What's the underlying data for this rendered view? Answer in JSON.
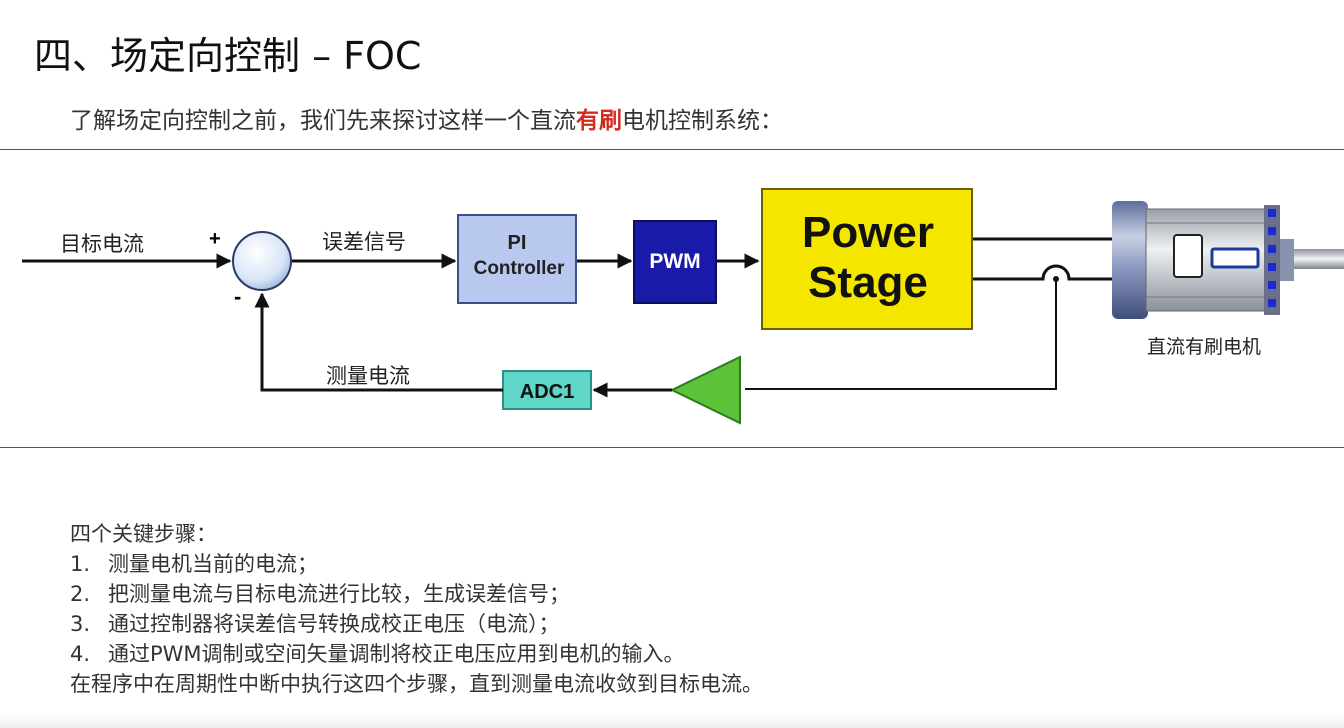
{
  "title": "四、场定向控制 – FOC",
  "intro": {
    "before": "了解场定向控制之前，我们先来探讨这样一个直流",
    "highlight": "有刷",
    "after": "电机控制系统："
  },
  "diagram": {
    "input_label": "目标电流",
    "plus_sign": "+",
    "minus_sign": "-",
    "error_label": "误差信号",
    "pi_line1": "PI",
    "pi_line2": "Controller",
    "pwm_label": "PWM",
    "power_line1": "Power",
    "power_line2": "Stage",
    "motor_label": "直流有刷电机",
    "feedback_label": "测量电流",
    "adc_label": "ADC1",
    "colors": {
      "pi_fill": "#b8c8ee",
      "pwm_fill": "#1a1aa8",
      "power_fill": "#f5e600",
      "adc_fill": "#5fd6c8",
      "amp_fill": "#5cc23a"
    }
  },
  "steps_heading": "四个关键步骤：",
  "steps": [
    {
      "num": "1.",
      "text": "测量电机当前的电流；"
    },
    {
      "num": "2.",
      "text": "把测量电流与目标电流进行比较，生成误差信号；"
    },
    {
      "num": "3.",
      "text": "通过控制器将误差信号转换成校正电压（电流）；"
    },
    {
      "num": "4.",
      "text": "通过PWM调制或空间矢量调制将校正电压应用到电机的输入。"
    }
  ],
  "footer_text": "在程序中在周期性中断中执行这四个步骤，直到测量电流收敛到目标电流。"
}
